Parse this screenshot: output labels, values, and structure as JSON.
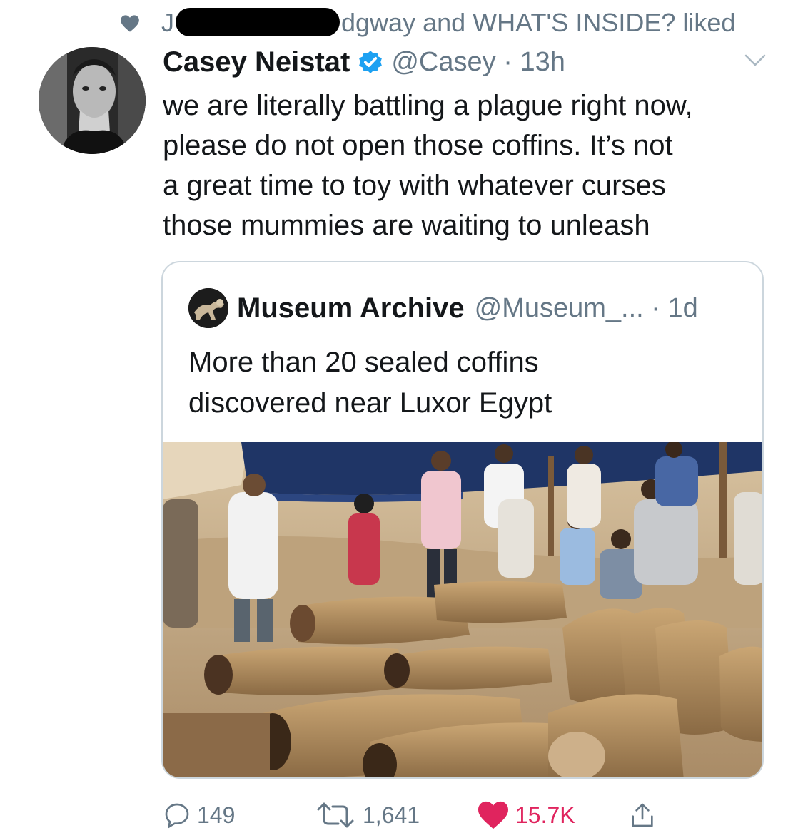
{
  "social_context": {
    "prefix": "J",
    "suffix": "dgway and WHAT'S INSIDE? liked"
  },
  "tweet": {
    "author_name": "Casey Neistat",
    "handle": "@Casey",
    "time": "13h",
    "text": "we are literally battling a plague right now,\nplease do not open those coffins.  It’s not\na great time to toy with whatever curses\nthose mummies are waiting to unleash"
  },
  "quote": {
    "author_name": "Museum Archive",
    "handle": "@Museum_...",
    "time": "1d",
    "text": "More than 20 sealed coffins\ndiscovered near Luxor Egypt"
  },
  "actions": {
    "replies": "149",
    "retweets": "1,641",
    "likes": "15.7K"
  },
  "icons": {
    "context": "heart-icon",
    "verified": "verified-badge-icon",
    "caret": "chevron-down-icon",
    "reply": "reply-icon",
    "retweet": "retweet-icon",
    "like": "heart-filled-icon",
    "share": "share-icon"
  },
  "colors": {
    "text": "#14171a",
    "secondary": "#657786",
    "verified": "#1da1f2",
    "like": "#e0245e",
    "border": "#ccd6dd"
  }
}
